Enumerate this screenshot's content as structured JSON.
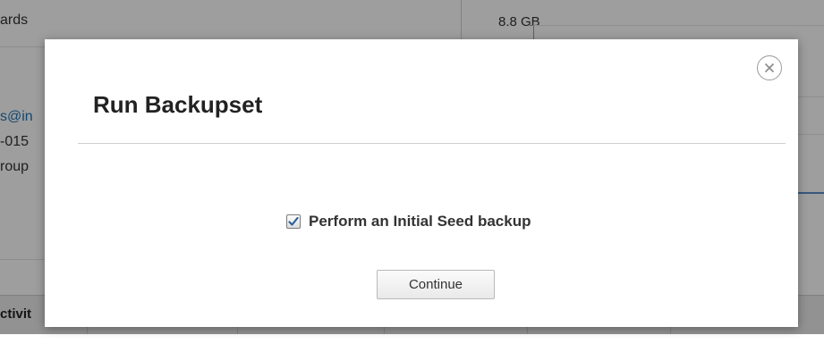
{
  "background": {
    "fragment_ards": "ards",
    "storage_value": "8.8 GB",
    "email_fragment": "s@in",
    "id_fragment": "-015",
    "group_fragment": "roup",
    "tab_activity_fragment": "ctivit"
  },
  "modal": {
    "title": "Run Backupset",
    "seed_checkbox_label": "Perform an Initial Seed backup",
    "seed_checked": true,
    "continue_label": "Continue"
  },
  "colors": {
    "overlay": "rgba(0,0,0,0.38)",
    "link": "#1f73b7",
    "checkmark": "#2f5f9e"
  }
}
